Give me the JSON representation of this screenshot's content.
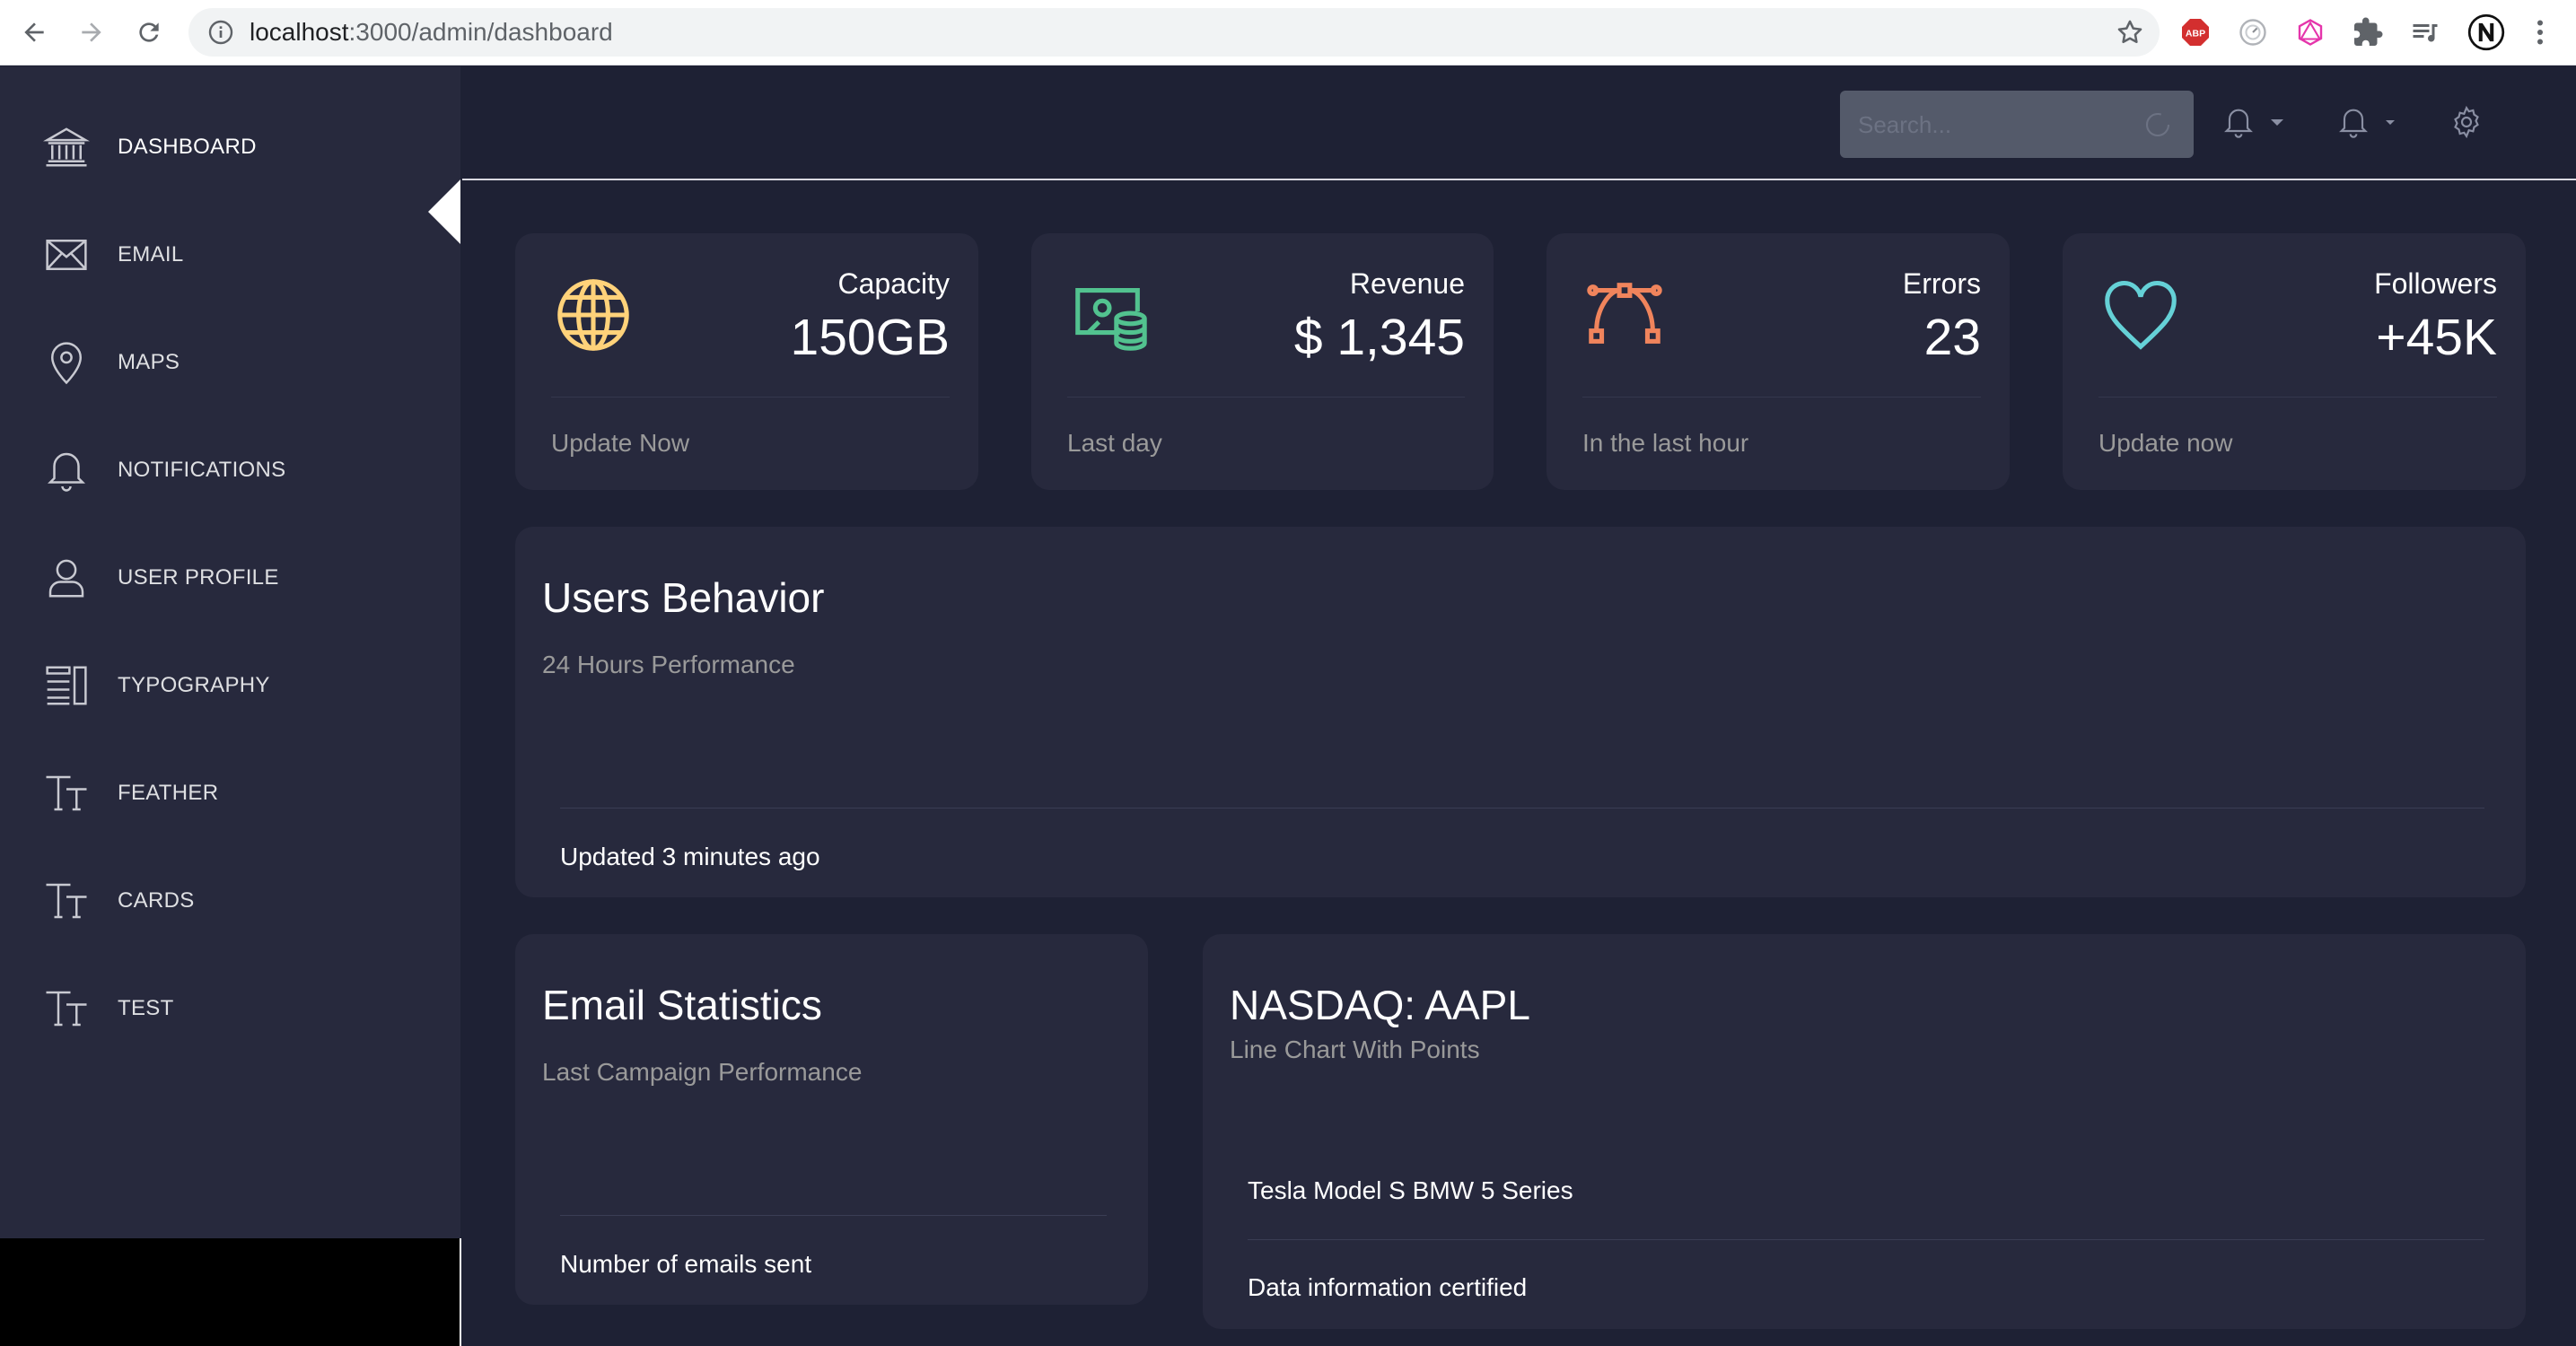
{
  "browser": {
    "url_host": "localhost",
    "url_rest": ":3000/admin/dashboard",
    "extensions": [
      "adblock-plus-icon",
      "timer-extension-icon",
      "graphql-extension-icon",
      "puzzle-extensions-icon",
      "media-control-icon",
      "profile-avatar-icon",
      "menu-kebab-icon"
    ]
  },
  "sidebar": {
    "items": [
      {
        "label": "DASHBOARD",
        "icon": "bank-icon"
      },
      {
        "label": "EMAIL",
        "icon": "envelope-icon"
      },
      {
        "label": "MAPS",
        "icon": "map-pin-icon"
      },
      {
        "label": "NOTIFICATIONS",
        "icon": "bell-icon"
      },
      {
        "label": "USER PROFILE",
        "icon": "user-icon"
      },
      {
        "label": "TYPOGRAPHY",
        "icon": "align-left-icon"
      },
      {
        "label": "FEATHER",
        "icon": "text-size-icon"
      },
      {
        "label": "CARDS",
        "icon": "text-size-icon"
      },
      {
        "label": "TEST",
        "icon": "text-size-icon"
      }
    ]
  },
  "topbar": {
    "search_placeholder": "Search..."
  },
  "stats": [
    {
      "category": "Capacity",
      "value": "150GB",
      "footer": "Update Now",
      "icon": "globe-icon",
      "color": "#ffd27a"
    },
    {
      "category": "Revenue",
      "value": "$ 1,345",
      "footer": "Last day",
      "icon": "money-coins-icon",
      "color": "#52c28f"
    },
    {
      "category": "Errors",
      "value": "23",
      "footer": "In the last hour",
      "icon": "vector-bezier-icon",
      "color": "#f0845c"
    },
    {
      "category": "Followers",
      "value": "+45K",
      "footer": "Update now",
      "icon": "heart-icon",
      "color": "#65d1d7"
    }
  ],
  "users_behavior": {
    "title": "Users Behavior",
    "subtitle": "24 Hours Performance",
    "footer": "Updated 3 minutes ago"
  },
  "email_statistics": {
    "title": "Email Statistics",
    "subtitle": "Last Campaign Performance",
    "footer": "Number of emails sent"
  },
  "nasdaq": {
    "title": "NASDAQ: AAPL",
    "subtitle": "Line Chart With Points",
    "legend": "Tesla Model S BMW 5 Series",
    "footer": "Data information certified"
  },
  "colors": {
    "sidebar_bg": "#27293d",
    "page_bg": "#1e2134",
    "card_bg": "#27293d"
  }
}
